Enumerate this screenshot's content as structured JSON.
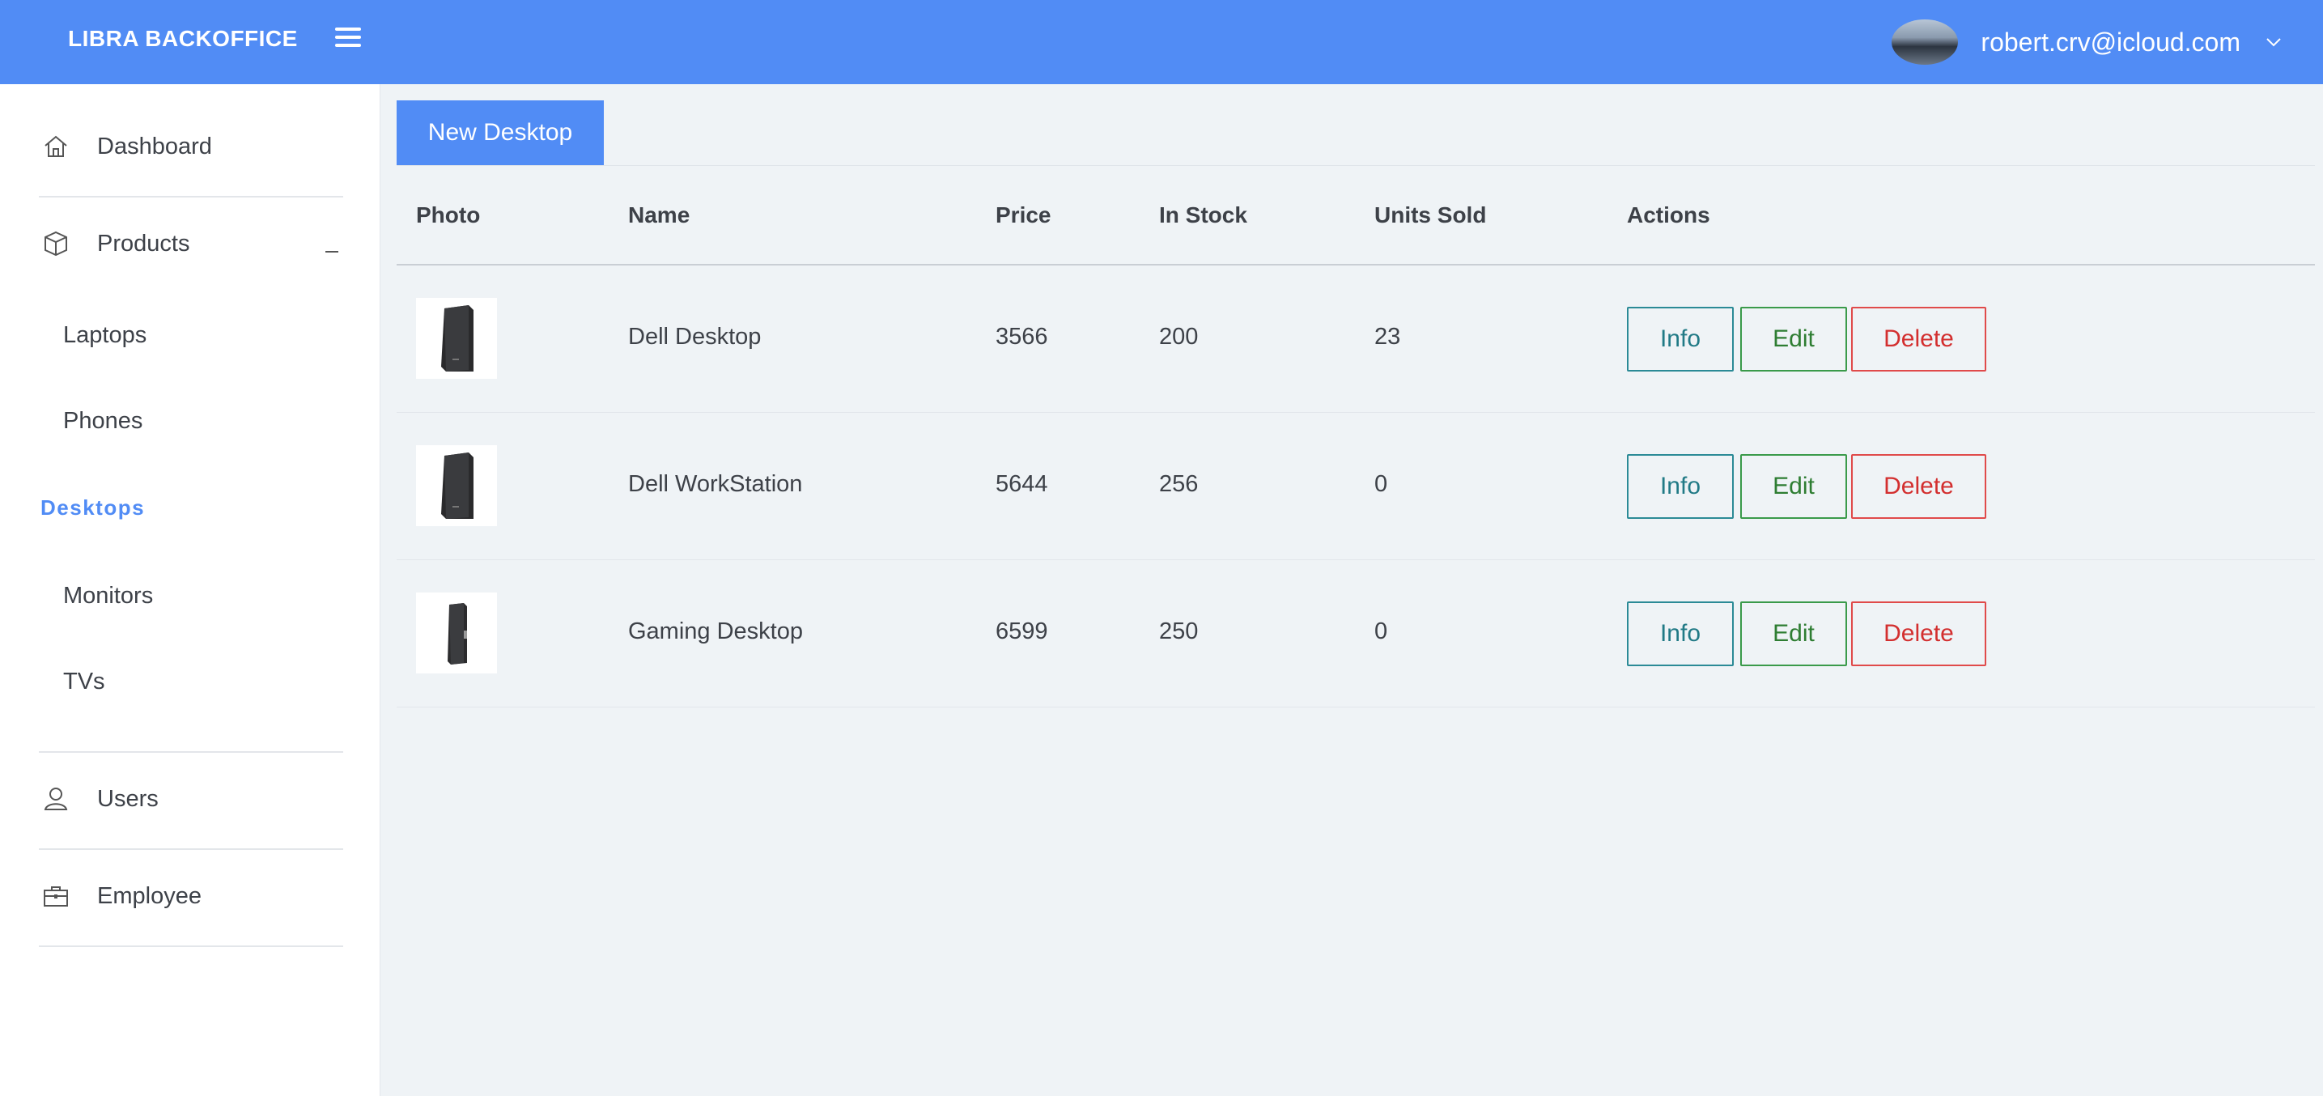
{
  "header": {
    "brand": "LIBRA BACKOFFICE",
    "menu_icon": "hamburger-icon",
    "user_email": "robert.crv@icloud.com",
    "user_menu_icon": "chevron-down-icon",
    "colors": {
      "bar": "#518cf5",
      "text": "#ffffff"
    }
  },
  "sidebar": {
    "dashboard": {
      "label": "Dashboard",
      "icon": "home-icon"
    },
    "products": {
      "label": "Products",
      "icon": "box-icon",
      "toggle": "collapse-icon"
    },
    "categories": [
      {
        "label": "Laptops"
      },
      {
        "label": "Phones"
      },
      {
        "label": "Desktops",
        "active": true
      },
      {
        "label": "Monitors"
      },
      {
        "label": "TVs"
      }
    ],
    "users": {
      "label": "Users",
      "icon": "user-icon"
    },
    "employee": {
      "label": "Employee",
      "icon": "briefcase-icon"
    },
    "active_color": "#518cf5"
  },
  "main": {
    "new_button": "New Desktop",
    "columns": [
      "Photo",
      "Name",
      "Price",
      "In Stock",
      "Units Sold",
      "Actions"
    ],
    "rows": [
      {
        "name": "Dell Desktop",
        "price": "3566",
        "in_stock": "200",
        "units_sold": "23",
        "photo_icon": "desktop-tower-icon"
      },
      {
        "name": "Dell WorkStation",
        "price": "5644",
        "in_stock": "256",
        "units_sold": "0",
        "photo_icon": "desktop-tower-icon"
      },
      {
        "name": "Gaming Desktop",
        "price": "6599",
        "in_stock": "250",
        "units_sold": "0",
        "photo_icon": "desktop-slim-icon"
      }
    ],
    "actions": {
      "info": "Info",
      "edit": "Edit",
      "delete": "Delete"
    },
    "action_colors": {
      "info": "#217a86",
      "edit": "#2e7d32",
      "delete": "#d32f2f"
    }
  }
}
